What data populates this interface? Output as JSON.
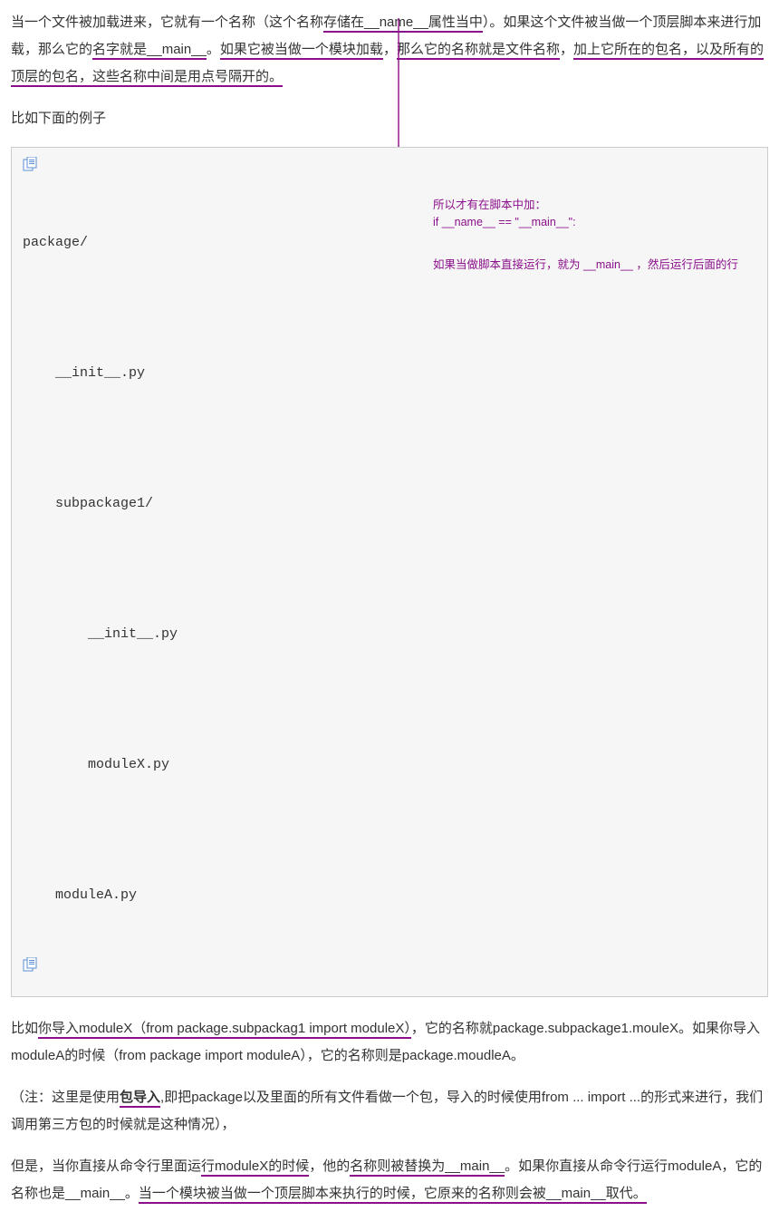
{
  "para1": {
    "t1": "当一个文件被加载进来，它就有一个名称（这个名称",
    "u1": "存储在__name__属性当中",
    "t2": "）。如果这个文件被当做一个顶层脚本来进行加载，那么它的",
    "u2": "名字就是__main__",
    "t3": "。",
    "u3": "如果它被当做一个模块加载",
    "t4": "，",
    "u4": "那么它的名称就是文件名称",
    "t5": "，",
    "u5": "加上它所在的包名，以及所有的顶层的包名，这些名称中间是用点号隔开的。"
  },
  "para2": "比如下面的例子",
  "code": {
    "l1": "package/",
    "l2": "",
    "l3": "    __init__.py",
    "l4": "",
    "l5": "    subpackage1/",
    "l6": "",
    "l7": "        __init__.py",
    "l8": "",
    "l9": "        moduleX.py",
    "l10": "",
    "l11": "    moduleA.py"
  },
  "annotation1": {
    "line1": "所以才有在脚本中加：",
    "line2": "if __name__ == \"__main__\":"
  },
  "annotation2": "如果当做脚本直接运行，就为 __main__ ，然后运行后面的行",
  "para3": {
    "t1": "比如",
    "u1": "你导入moduleX（from package.subpackag1 import moduleX）",
    "t2": "，它的名称就package.subpackage1.mouleX。如果你导入moduleA的时候（from package import moduleA），它的名称则是package.moudleA。"
  },
  "para4": {
    "t1": "（注：这里是使用",
    "bu1": "包导入",
    "t2": ",即把package以及里面的所有文件看做一个包，导入的时候使用from ... import ...的形式来进行，我们调用第三方包的时候就是这种情况），"
  },
  "para5": {
    "t1": "但是，当你直接从命令行里面运",
    "u1": "行moduleX的时候",
    "t2": "，他的",
    "u2": "名称则被替换为__main__",
    "t3": "。如果你直接从命令行运行moduleA，它的名称也是__main__。",
    "u3": "当一个模块被当做一个顶层脚本来执行的时候，它原来的名称则会被__main__取代。"
  }
}
